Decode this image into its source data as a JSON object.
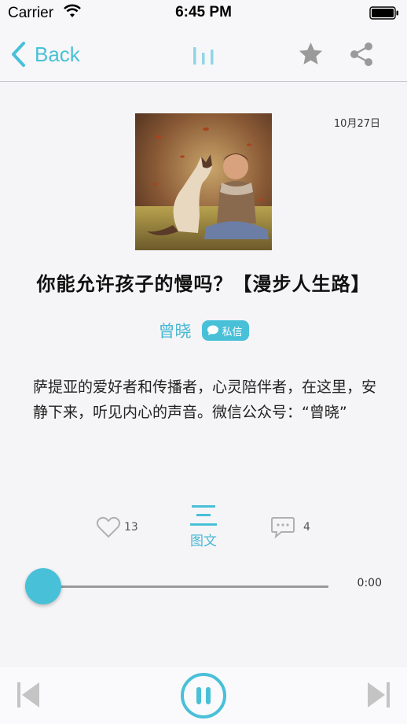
{
  "status_bar": {
    "carrier": "Carrier",
    "time": "6:45 PM"
  },
  "nav": {
    "back_label": "Back",
    "icons": [
      "chevron-left-icon",
      "audio-playing-icon",
      "star-icon",
      "share-icon"
    ]
  },
  "article": {
    "date": "10月27日",
    "title": "你能允许孩子的慢吗？【漫步人生路】",
    "author": "曾晓",
    "message_label": "私信",
    "description": "萨提亚的爱好者和传播者，心灵陪伴者，在这里，安静下来，听见内心的声音。微信公众号：“曾晓”"
  },
  "actions": {
    "like_count": "13",
    "article_label": "图文",
    "comment_count": "4"
  },
  "player": {
    "elapsed": "0:00",
    "progress_fraction": 0,
    "state": "playing"
  },
  "colors": {
    "accent": "#48c0d8",
    "icon_gray": "#9a9a9a"
  }
}
